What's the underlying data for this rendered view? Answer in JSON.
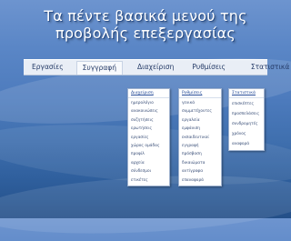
{
  "slide": {
    "title_line1": "Τα πέντε βασικά μενού της",
    "title_line2": "προβολής επεξεργασίας"
  },
  "menubar": {
    "items": [
      {
        "label": "Εργασίες"
      },
      {
        "label": "Συγγραφή"
      },
      {
        "label": "Διαχείριση"
      },
      {
        "label": "Ρυθμίσεις"
      },
      {
        "label": "Στατιστικά"
      }
    ],
    "active_item": "Συγγραφή"
  },
  "dropdowns": {
    "writing": {
      "header": "Διαχείριση",
      "items": [
        "ημερολόγιο",
        "ανακοινώσεις",
        "συζητήσεις",
        "ερωτήσεις",
        "εργασίες",
        "χώρος ομάδας",
        "προφίλ",
        "αρχεία",
        "σύνδεσμοι",
        "ετικέτες"
      ]
    },
    "settings": {
      "header": "Ρυθμίσεις",
      "items": [
        "γενικά",
        "συμμετέχοντες",
        "εργαλεία",
        "εμφάνιση",
        "εκπαιδευτικοί",
        "εγγραφή",
        "πρόσβαση",
        "δικαιώματα",
        "αντίγραφα",
        "επαναφορά"
      ]
    },
    "stats": {
      "header": "Στατιστικά",
      "items": [
        "επισκέπτες",
        "προσπελάσεις",
        "συνδρομητές",
        "χρόνος",
        "αναφορά"
      ]
    }
  },
  "colors": {
    "background_top": "#6d94cf",
    "background_bottom": "#234f88",
    "menubar": "#e9eef6",
    "title_text": "#ffffff"
  }
}
